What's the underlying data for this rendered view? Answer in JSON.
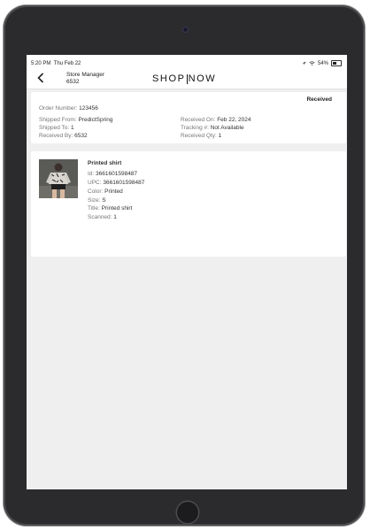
{
  "status_bar": {
    "time": "5:20 PM",
    "date": "Thu Feb 22",
    "battery": "54%",
    "battery_level": 0.54
  },
  "header": {
    "store_label": "Store Manager",
    "store_number": "6532",
    "logo_left": "SHOP",
    "logo_right": "NOW"
  },
  "order": {
    "status": "Received",
    "order_number_label": "Order Number:",
    "order_number": "123456",
    "shipped_from_label": "Shipped From:",
    "shipped_from": "PredictSpring",
    "shipped_to_label": "Shipped To:",
    "shipped_to": "1",
    "received_by_label": "Received By:",
    "received_by": "6532",
    "received_on_label": "Received On:",
    "received_on": "Feb 22, 2024",
    "tracking_label": "Tracking #:",
    "tracking": "Not Available",
    "received_qty_label": "Received Qty:",
    "received_qty": "1"
  },
  "item": {
    "name": "Printed shirt",
    "id_label": "Id:",
    "id": "3661601598487",
    "upc_label": "UPC:",
    "upc": "3661601598487",
    "color_label": "Color:",
    "color": "Printed",
    "size_label": "Size:",
    "size": "S",
    "title_label": "Title:",
    "title": "Printed shirt",
    "scanned_label": "Scanned:",
    "scanned": "1"
  },
  "icons": {
    "back": "chevron-left-icon",
    "wifi": "wifi-icon",
    "signal": "location-icon",
    "battery": "battery-icon"
  },
  "colors": {
    "background": "#efefef",
    "card": "#ffffff",
    "device": "#2b2b2d"
  }
}
